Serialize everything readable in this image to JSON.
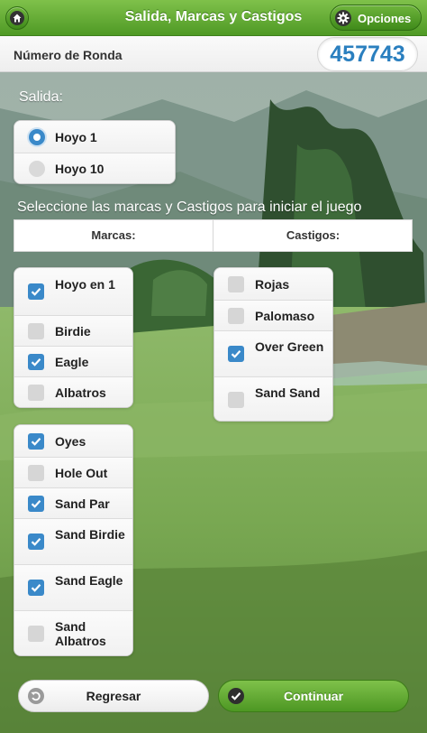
{
  "header": {
    "title": "Salida, Marcas y Castigos",
    "options_label": "Opciones",
    "home_icon": "home-icon",
    "gear_icon": "gear-icon",
    "bar_color": "#5fa631"
  },
  "round": {
    "label": "Número de Ronda",
    "number": "457743",
    "number_color": "#2a7fbf"
  },
  "salida": {
    "label": "Salida:",
    "options": [
      {
        "label": "Hoyo 1",
        "selected": true
      },
      {
        "label": "Hoyo 10",
        "selected": false
      }
    ]
  },
  "instructions": "Seleccione las marcas y Castigos para iniciar el juego",
  "table": {
    "marcas_header": "Marcas:",
    "castigos_header": "Castigos:"
  },
  "marcas": [
    {
      "label": "Hoyo en 1",
      "checked": true
    },
    {
      "label": "Birdie",
      "checked": false
    },
    {
      "label": "Eagle",
      "checked": true
    },
    {
      "label": "Albatros",
      "checked": false
    }
  ],
  "marcas_sand": [
    {
      "label": "Oyes",
      "checked": true
    },
    {
      "label": "Hole Out",
      "checked": false
    },
    {
      "label": "Sand Par",
      "checked": true
    },
    {
      "label": "Sand Birdie",
      "checked": true
    },
    {
      "label": "Sand Eagle",
      "checked": true
    },
    {
      "label": "Sand Albatros",
      "checked": false
    }
  ],
  "castigos": [
    {
      "label": "Rojas",
      "checked": false
    },
    {
      "label": "Palomaso",
      "checked": false
    },
    {
      "label": "Over Green",
      "checked": true
    },
    {
      "label": "Sand Sand",
      "checked": false
    }
  ],
  "footer": {
    "back_label": "Regresar",
    "continue_label": "Continuar",
    "back_icon": "back-arrow-icon",
    "continue_icon": "check-icon"
  },
  "colors": {
    "accent_blue": "#3a89c9",
    "green": "#5fa631"
  }
}
